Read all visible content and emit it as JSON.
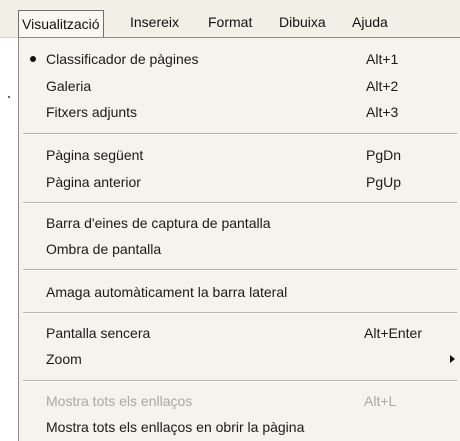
{
  "menubar": {
    "items": [
      {
        "label": "Visualització"
      },
      {
        "label": "Insereix"
      },
      {
        "label": "Format"
      },
      {
        "label": "Dibuixa"
      },
      {
        "label": "Ajuda"
      }
    ]
  },
  "dropdown": {
    "items": [
      {
        "label": "Classificador de pàgines",
        "shortcut": "Alt+1",
        "selected": true
      },
      {
        "label": "Galeria",
        "shortcut": "Alt+2"
      },
      {
        "label": "Fitxers adjunts",
        "shortcut": "Alt+3"
      },
      {
        "label": "Pàgina següent",
        "shortcut": "PgDn"
      },
      {
        "label": "Pàgina anterior",
        "shortcut": "PgUp"
      },
      {
        "label": "Barra d'eines de captura de pantalla"
      },
      {
        "label": "Ombra de pantalla"
      },
      {
        "label": "Amaga automàticament la barra lateral"
      },
      {
        "label": "Pantalla sencera",
        "shortcut": "Alt+Enter"
      },
      {
        "label": "Zoom",
        "submenu": true
      },
      {
        "label": "Mostra tots els enllaços",
        "shortcut": "Alt+L",
        "disabled": true
      },
      {
        "label": "Mostra tots els enllaços en obrir la pàgina"
      }
    ]
  }
}
